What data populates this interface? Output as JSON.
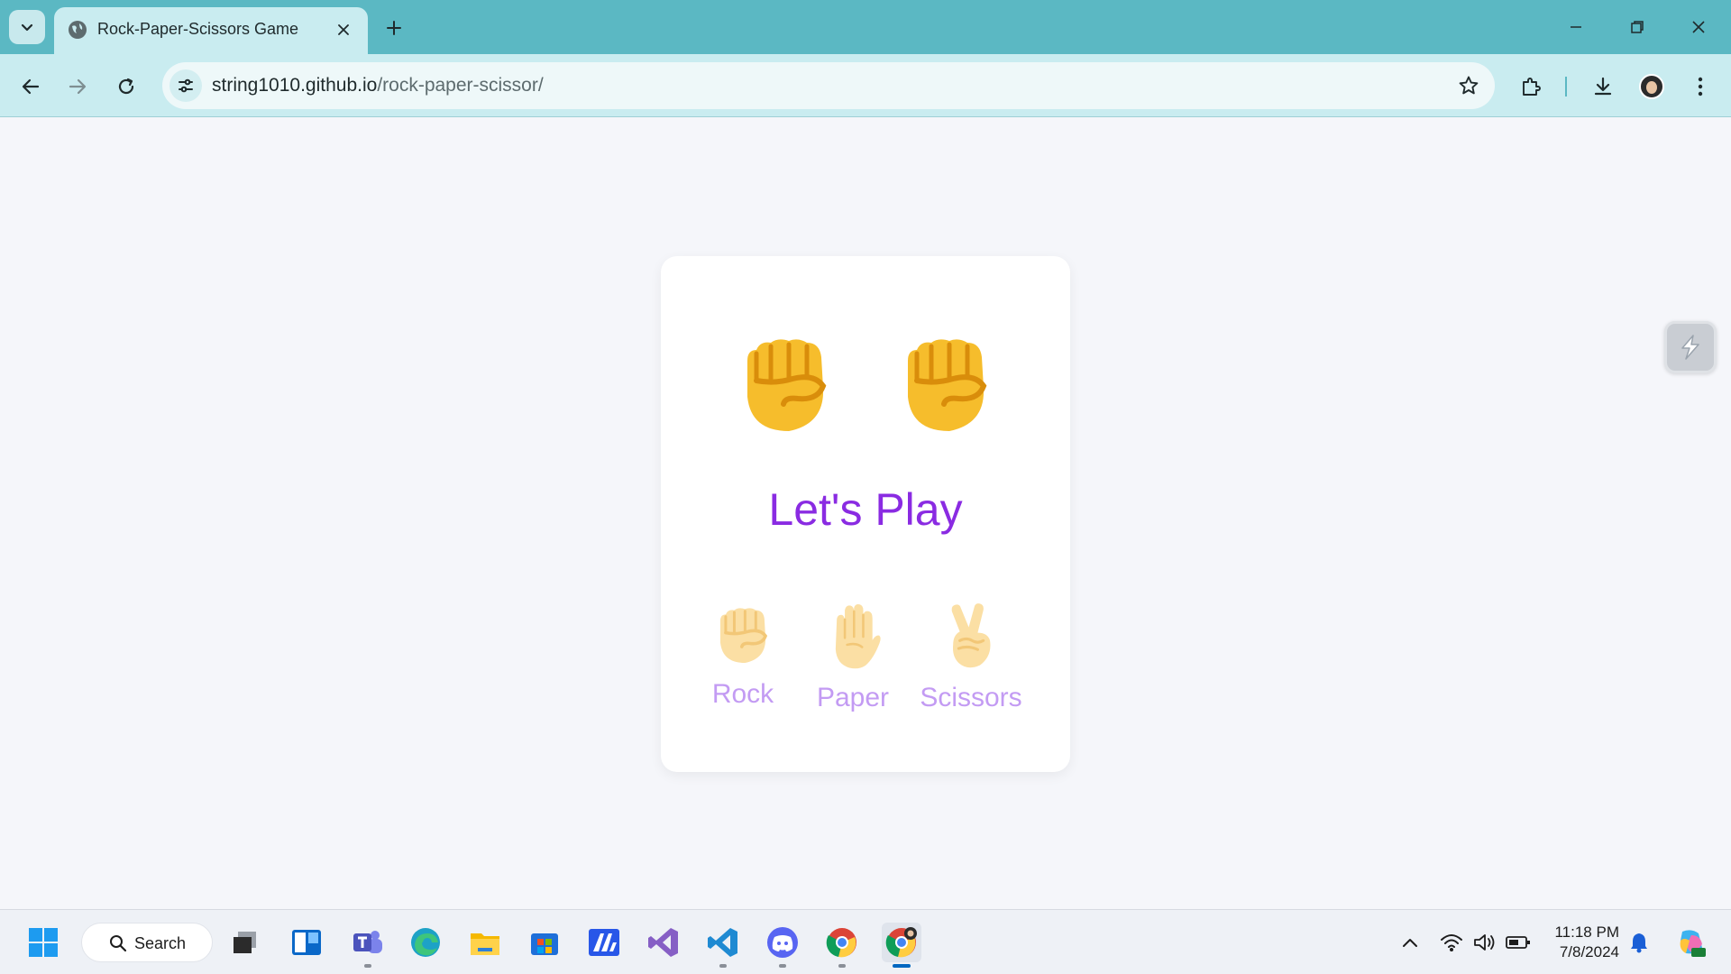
{
  "browser": {
    "tab_title": "Rock-Paper-Scissors Game",
    "url_host": "string1010.github.io",
    "url_path": "/rock-paper-scissor/"
  },
  "game": {
    "title": "Let's Play",
    "player_hand": "rock",
    "computer_hand": "rock",
    "choices": [
      {
        "label": "Rock"
      },
      {
        "label": "Paper"
      },
      {
        "label": "Scissors"
      }
    ],
    "colors": {
      "title": "#8a2be2",
      "choice_label": "#c39bf3",
      "hand": "#f6bd2c",
      "hand_shadow": "#d98d0b"
    }
  },
  "taskbar": {
    "search_label": "Search",
    "time": "11:18 PM",
    "date": "7/8/2024",
    "apps": [
      "windows-start-icon",
      "task-view-icon",
      "widgets-icon",
      "teams-icon",
      "edge-icon",
      "file-explorer-icon",
      "store-icon",
      "app-icon",
      "visual-studio-icon",
      "vscode-icon",
      "discord-icon",
      "chrome-icon",
      "chrome-profile-icon"
    ]
  }
}
